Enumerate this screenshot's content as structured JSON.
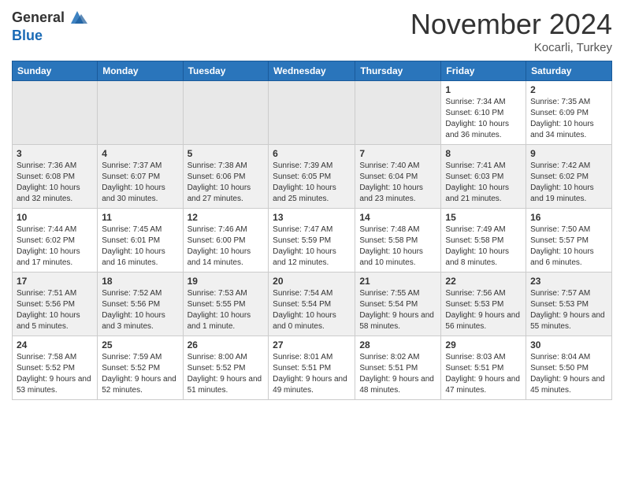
{
  "header": {
    "logo_line1": "General",
    "logo_line2": "Blue",
    "month_year": "November 2024",
    "location": "Kocarli, Turkey"
  },
  "weekdays": [
    "Sunday",
    "Monday",
    "Tuesday",
    "Wednesday",
    "Thursday",
    "Friday",
    "Saturday"
  ],
  "weeks": [
    {
      "days": [
        {
          "date": "",
          "info": ""
        },
        {
          "date": "",
          "info": ""
        },
        {
          "date": "",
          "info": ""
        },
        {
          "date": "",
          "info": ""
        },
        {
          "date": "",
          "info": ""
        },
        {
          "date": "1",
          "info": "Sunrise: 7:34 AM\nSunset: 6:10 PM\nDaylight: 10 hours and 36 minutes."
        },
        {
          "date": "2",
          "info": "Sunrise: 7:35 AM\nSunset: 6:09 PM\nDaylight: 10 hours and 34 minutes."
        }
      ]
    },
    {
      "days": [
        {
          "date": "3",
          "info": "Sunrise: 7:36 AM\nSunset: 6:08 PM\nDaylight: 10 hours and 32 minutes."
        },
        {
          "date": "4",
          "info": "Sunrise: 7:37 AM\nSunset: 6:07 PM\nDaylight: 10 hours and 30 minutes."
        },
        {
          "date": "5",
          "info": "Sunrise: 7:38 AM\nSunset: 6:06 PM\nDaylight: 10 hours and 27 minutes."
        },
        {
          "date": "6",
          "info": "Sunrise: 7:39 AM\nSunset: 6:05 PM\nDaylight: 10 hours and 25 minutes."
        },
        {
          "date": "7",
          "info": "Sunrise: 7:40 AM\nSunset: 6:04 PM\nDaylight: 10 hours and 23 minutes."
        },
        {
          "date": "8",
          "info": "Sunrise: 7:41 AM\nSunset: 6:03 PM\nDaylight: 10 hours and 21 minutes."
        },
        {
          "date": "9",
          "info": "Sunrise: 7:42 AM\nSunset: 6:02 PM\nDaylight: 10 hours and 19 minutes."
        }
      ]
    },
    {
      "days": [
        {
          "date": "10",
          "info": "Sunrise: 7:44 AM\nSunset: 6:02 PM\nDaylight: 10 hours and 17 minutes."
        },
        {
          "date": "11",
          "info": "Sunrise: 7:45 AM\nSunset: 6:01 PM\nDaylight: 10 hours and 16 minutes."
        },
        {
          "date": "12",
          "info": "Sunrise: 7:46 AM\nSunset: 6:00 PM\nDaylight: 10 hours and 14 minutes."
        },
        {
          "date": "13",
          "info": "Sunrise: 7:47 AM\nSunset: 5:59 PM\nDaylight: 10 hours and 12 minutes."
        },
        {
          "date": "14",
          "info": "Sunrise: 7:48 AM\nSunset: 5:58 PM\nDaylight: 10 hours and 10 minutes."
        },
        {
          "date": "15",
          "info": "Sunrise: 7:49 AM\nSunset: 5:58 PM\nDaylight: 10 hours and 8 minutes."
        },
        {
          "date": "16",
          "info": "Sunrise: 7:50 AM\nSunset: 5:57 PM\nDaylight: 10 hours and 6 minutes."
        }
      ]
    },
    {
      "days": [
        {
          "date": "17",
          "info": "Sunrise: 7:51 AM\nSunset: 5:56 PM\nDaylight: 10 hours and 5 minutes."
        },
        {
          "date": "18",
          "info": "Sunrise: 7:52 AM\nSunset: 5:56 PM\nDaylight: 10 hours and 3 minutes."
        },
        {
          "date": "19",
          "info": "Sunrise: 7:53 AM\nSunset: 5:55 PM\nDaylight: 10 hours and 1 minute."
        },
        {
          "date": "20",
          "info": "Sunrise: 7:54 AM\nSunset: 5:54 PM\nDaylight: 10 hours and 0 minutes."
        },
        {
          "date": "21",
          "info": "Sunrise: 7:55 AM\nSunset: 5:54 PM\nDaylight: 9 hours and 58 minutes."
        },
        {
          "date": "22",
          "info": "Sunrise: 7:56 AM\nSunset: 5:53 PM\nDaylight: 9 hours and 56 minutes."
        },
        {
          "date": "23",
          "info": "Sunrise: 7:57 AM\nSunset: 5:53 PM\nDaylight: 9 hours and 55 minutes."
        }
      ]
    },
    {
      "days": [
        {
          "date": "24",
          "info": "Sunrise: 7:58 AM\nSunset: 5:52 PM\nDaylight: 9 hours and 53 minutes."
        },
        {
          "date": "25",
          "info": "Sunrise: 7:59 AM\nSunset: 5:52 PM\nDaylight: 9 hours and 52 minutes."
        },
        {
          "date": "26",
          "info": "Sunrise: 8:00 AM\nSunset: 5:52 PM\nDaylight: 9 hours and 51 minutes."
        },
        {
          "date": "27",
          "info": "Sunrise: 8:01 AM\nSunset: 5:51 PM\nDaylight: 9 hours and 49 minutes."
        },
        {
          "date": "28",
          "info": "Sunrise: 8:02 AM\nSunset: 5:51 PM\nDaylight: 9 hours and 48 minutes."
        },
        {
          "date": "29",
          "info": "Sunrise: 8:03 AM\nSunset: 5:51 PM\nDaylight: 9 hours and 47 minutes."
        },
        {
          "date": "30",
          "info": "Sunrise: 8:04 AM\nSunset: 5:50 PM\nDaylight: 9 hours and 45 minutes."
        }
      ]
    }
  ]
}
